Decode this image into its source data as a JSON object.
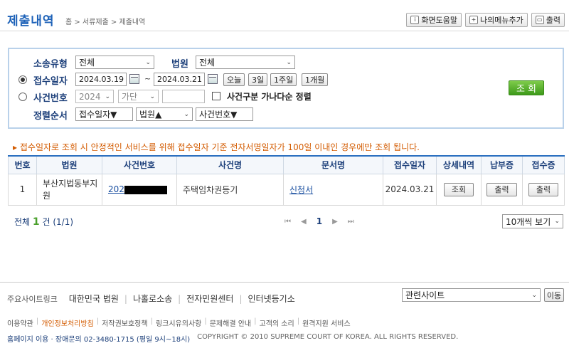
{
  "header": {
    "title": "제출내역",
    "breadcrumb": "홈 > 서류제출 > 제출내역",
    "buttons": [
      {
        "label": "화면도움말",
        "icon": "info-icon"
      },
      {
        "label": "나의메뉴추가",
        "icon": "add-menu-icon"
      },
      {
        "label": "출력",
        "icon": "print-icon"
      }
    ]
  },
  "search": {
    "lawsuit_type_label": "소송유형",
    "lawsuit_type_value": "전체",
    "court_label": "법원",
    "court_value": "전체",
    "receipt_date_label": "접수일자",
    "date_from": "2024.03.19",
    "date_sep": "~",
    "date_to": "2024.03.21",
    "quick_dates": [
      "오늘",
      "3일",
      "1주일",
      "1개월"
    ],
    "case_no_label": "사건번호",
    "case_year": "2024",
    "case_kind": "가단",
    "case_no_value": "",
    "case_sort_checkbox_label": "사건구분 가나다순 정렬",
    "sort_label": "정렬순서",
    "sort_options": [
      "접수일자▼",
      "법원▲",
      "사건번호▼"
    ],
    "search_button": "조 회",
    "selected_radio": "receipt-date"
  },
  "notice": "접수일자로 조회 시 안정적인 서비스를 위해 접수일자 기준 전자서명일자가 100일 이내인 경우에만 조회 됩니다.",
  "table": {
    "headers": [
      "번호",
      "법원",
      "사건번호",
      "사건명",
      "문서명",
      "접수일자",
      "상세내역",
      "납부증",
      "접수증"
    ],
    "rows": [
      {
        "no": "1",
        "court": "부산지법동부지원",
        "case_no_prefix": "202",
        "case_name": "주택임차권등기",
        "doc_name": "신청서",
        "date": "2024.03.21",
        "detail_btn": "조회",
        "payment_btn": "출력",
        "receipt_btn": "출력"
      }
    ]
  },
  "pagination": {
    "total_prefix": "전체",
    "total_count": "1",
    "total_suffix": "건 (1/1)",
    "first": "⏮",
    "prev": "◀",
    "current": "1",
    "next": "▶",
    "last": "⏭",
    "per_page": "10개씩 보기"
  },
  "footer": {
    "links_title": "주요사이트링크",
    "links": [
      "대한민국 법원",
      "나홀로소송",
      "전자민원센터",
      "인터넷등기소"
    ],
    "related_select": "관련사이트",
    "go_button": "이동",
    "menu": [
      "이용약관",
      "개인정보처리방침",
      "저작권보호정책",
      "링크시유의사항",
      "문제해결 안내",
      "고객의 소리",
      "원격지원 서비스"
    ],
    "contact": "홈페이지 이용 · 장애문의 02-3480-1715 (평일 9시~18시)",
    "copyright": "COPYRIGHT © 2010 SUPREME COURT OF KOREA. ALL RIGHTS RESERVED."
  }
}
